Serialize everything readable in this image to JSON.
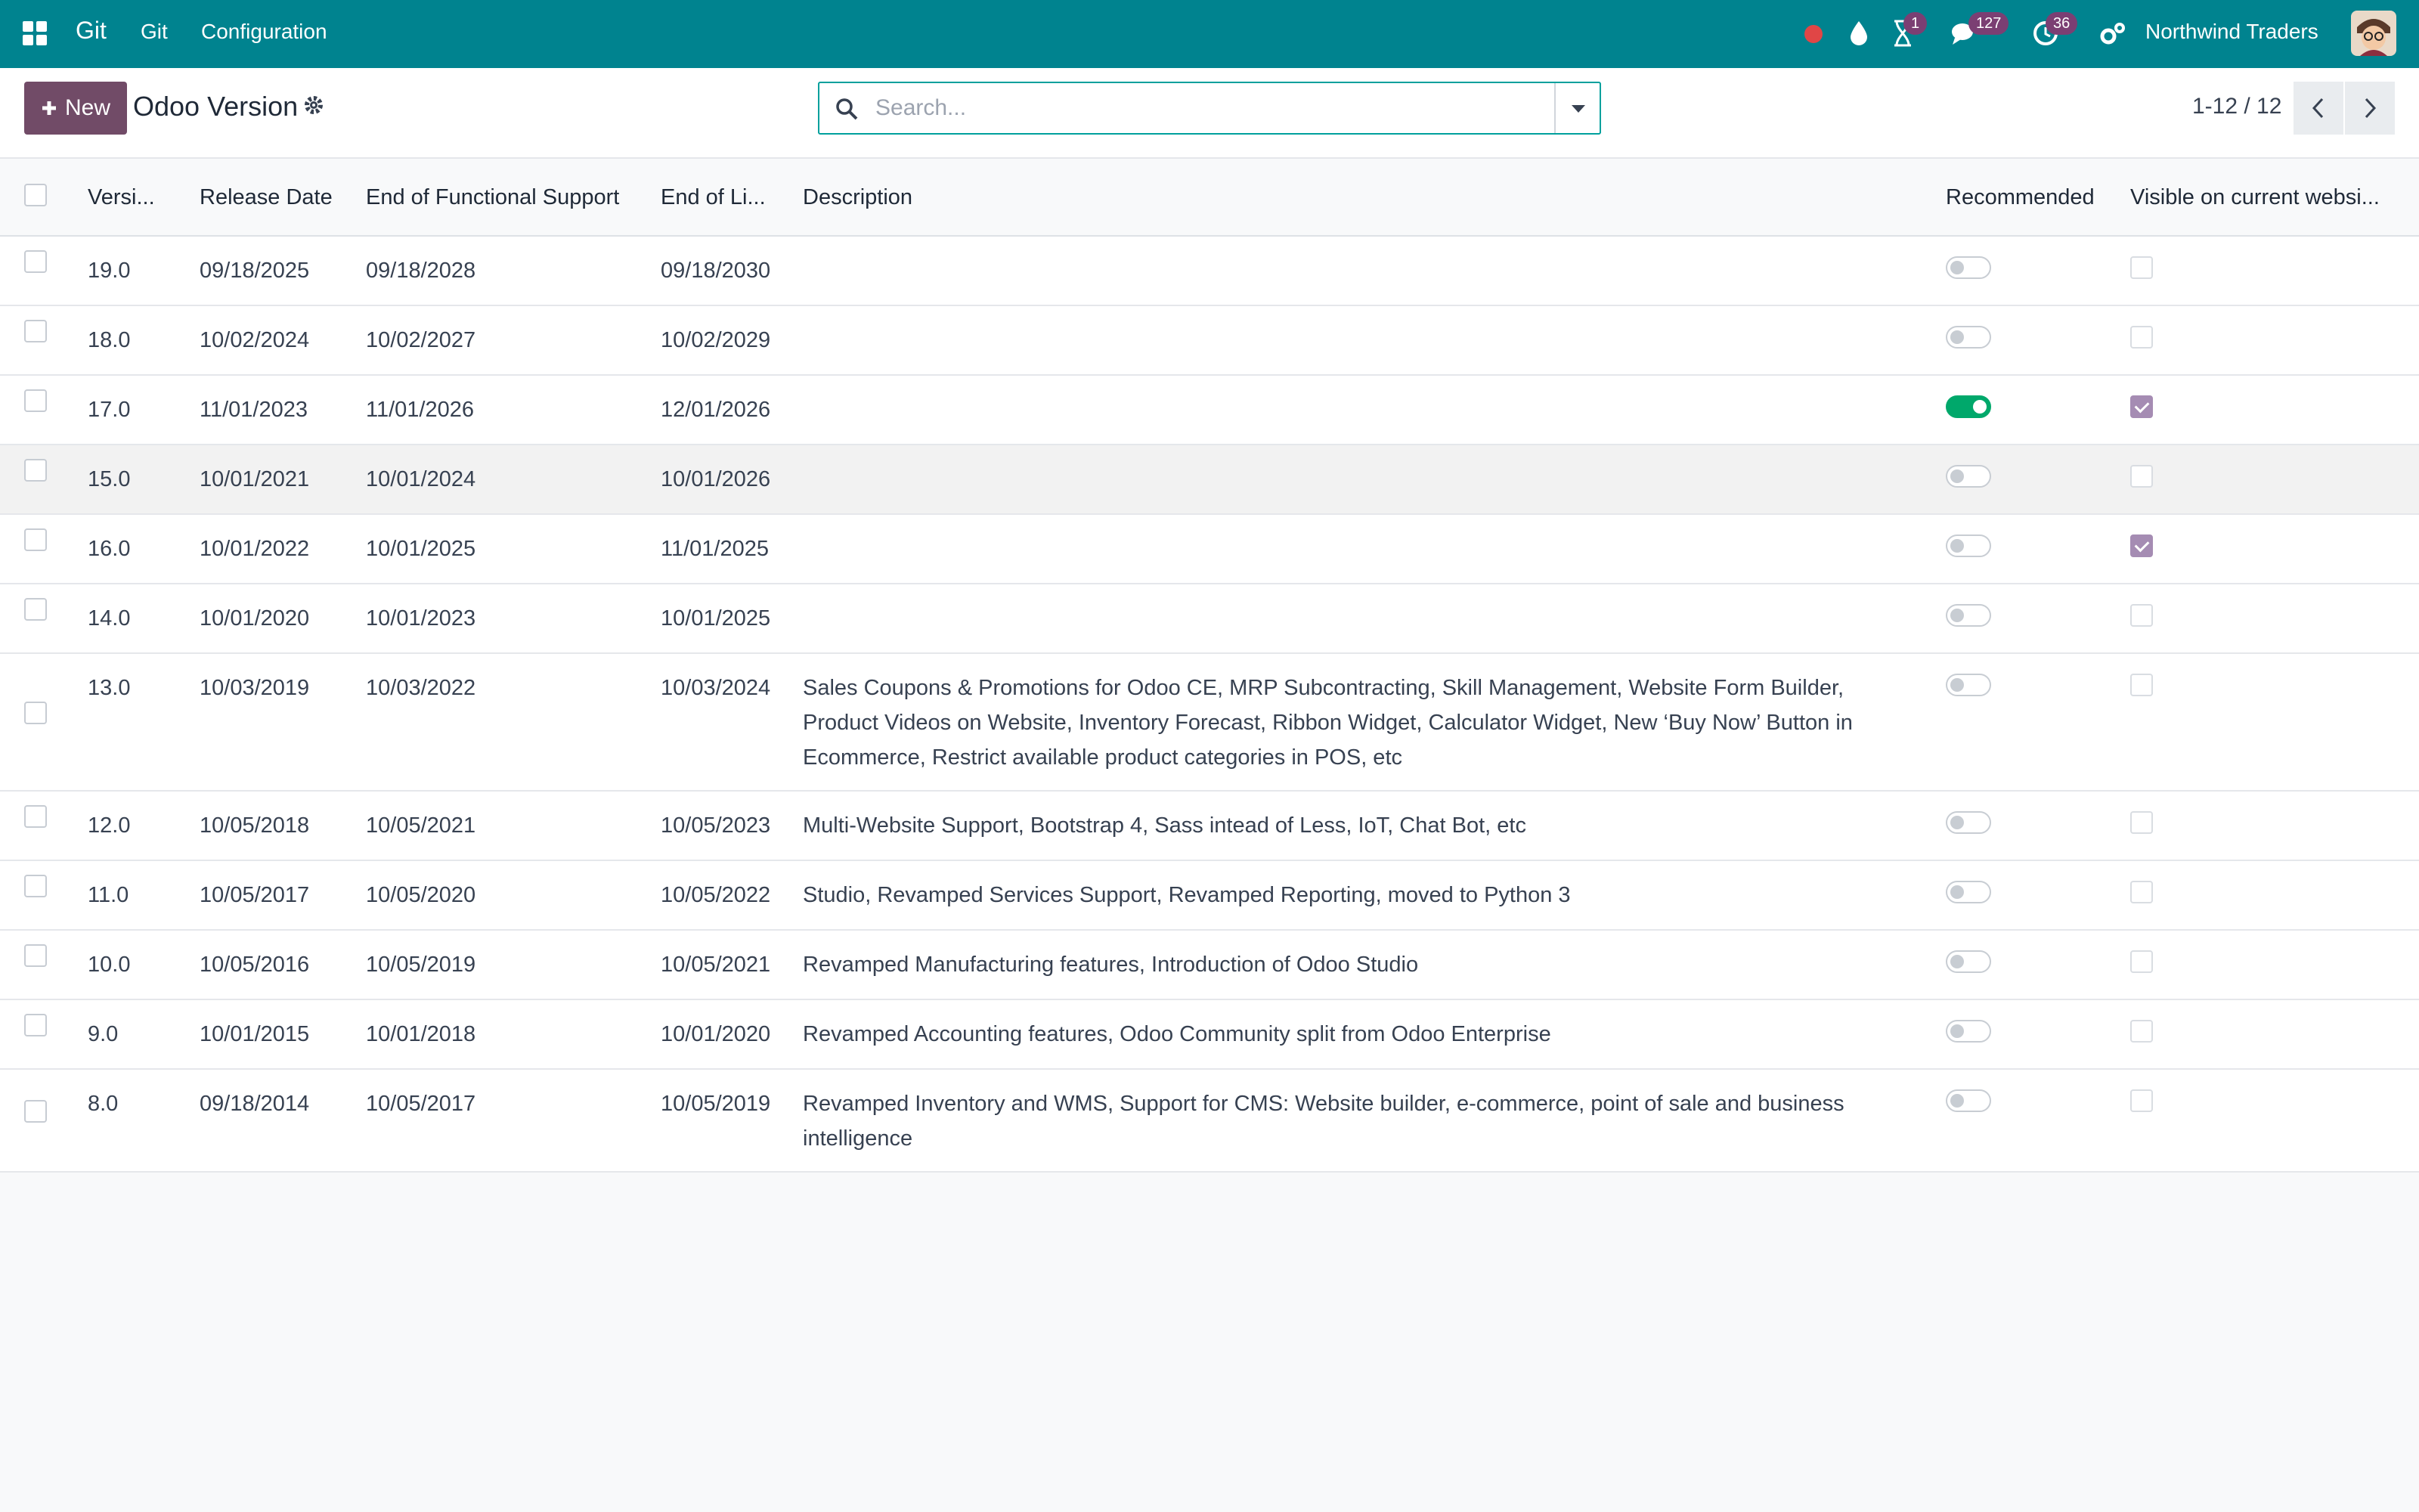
{
  "topbar": {
    "app_name": "Git",
    "menu": [
      "Git",
      "Configuration"
    ],
    "badges": {
      "activity": "1",
      "messages": "127",
      "clock": "36"
    },
    "company": "Northwind Traders",
    "icons": [
      "apps-grid-icon",
      "record-dot-icon",
      "drop-icon",
      "hourglass-icon",
      "chat-icon",
      "clock-icon",
      "settings-icon"
    ],
    "accent_color": "#00838f"
  },
  "control": {
    "new_label": "New",
    "title": "Odoo Version",
    "search_placeholder": "Search...",
    "pager": "1-12 / 12"
  },
  "table": {
    "headers": [
      "Versi...",
      "Release Date",
      "End of Functional Support",
      "End of Li...",
      "Description",
      "Recommended",
      "Visible on current websi..."
    ],
    "rows": [
      {
        "version": "19.0",
        "release": "09/18/2025",
        "eofs": "09/18/2028",
        "eol": "09/18/2030",
        "description": "",
        "recommended": false,
        "visible": false
      },
      {
        "version": "18.0",
        "release": "10/02/2024",
        "eofs": "10/02/2027",
        "eol": "10/02/2029",
        "description": "",
        "recommended": false,
        "visible": false
      },
      {
        "version": "17.0",
        "release": "11/01/2023",
        "eofs": "11/01/2026",
        "eol": "12/01/2026",
        "description": "",
        "recommended": true,
        "visible": true
      },
      {
        "version": "15.0",
        "release": "10/01/2021",
        "eofs": "10/01/2024",
        "eol": "10/01/2026",
        "description": "",
        "recommended": false,
        "visible": false
      },
      {
        "version": "16.0",
        "release": "10/01/2022",
        "eofs": "10/01/2025",
        "eol": "11/01/2025",
        "description": "",
        "recommended": false,
        "visible": true
      },
      {
        "version": "14.0",
        "release": "10/01/2020",
        "eofs": "10/01/2023",
        "eol": "10/01/2025",
        "description": "",
        "recommended": false,
        "visible": false
      },
      {
        "version": "13.0",
        "release": "10/03/2019",
        "eofs": "10/03/2022",
        "eol": "10/03/2024",
        "description": "Sales Coupons & Promotions for Odoo CE, MRP Subcontracting, Skill Management, Website Form Builder, Product Videos on Website, Inventory Forecast, Ribbon Widget, Calculator Widget, New ‘Buy Now’ Button in Ecommerce, Restrict available product categories in POS, etc",
        "recommended": false,
        "visible": false
      },
      {
        "version": "12.0",
        "release": "10/05/2018",
        "eofs": "10/05/2021",
        "eol": "10/05/2023",
        "description": "Multi-Website Support, Bootstrap 4, Sass intead of Less, IoT, Chat Bot, etc",
        "recommended": false,
        "visible": false
      },
      {
        "version": "11.0",
        "release": "10/05/2017",
        "eofs": "10/05/2020",
        "eol": "10/05/2022",
        "description": "Studio, Revamped Services Support, Revamped Reporting, moved to Python 3",
        "recommended": false,
        "visible": false
      },
      {
        "version": "10.0",
        "release": "10/05/2016",
        "eofs": "10/05/2019",
        "eol": "10/05/2021",
        "description": "Revamped Manufacturing features, Introduction of Odoo Studio",
        "recommended": false,
        "visible": false
      },
      {
        "version": "9.0",
        "release": "10/01/2015",
        "eofs": "10/01/2018",
        "eol": "10/01/2020",
        "description": "Revamped Accounting features, Odoo Community split from Odoo Enterprise",
        "recommended": false,
        "visible": false
      },
      {
        "version": "8.0",
        "release": "09/18/2014",
        "eofs": "10/05/2017",
        "eol": "10/05/2019",
        "description": "Revamped Inventory and WMS, Support for CMS: Website builder, e-commerce, point of sale and business intelligence",
        "recommended": false,
        "visible": false
      }
    ]
  }
}
